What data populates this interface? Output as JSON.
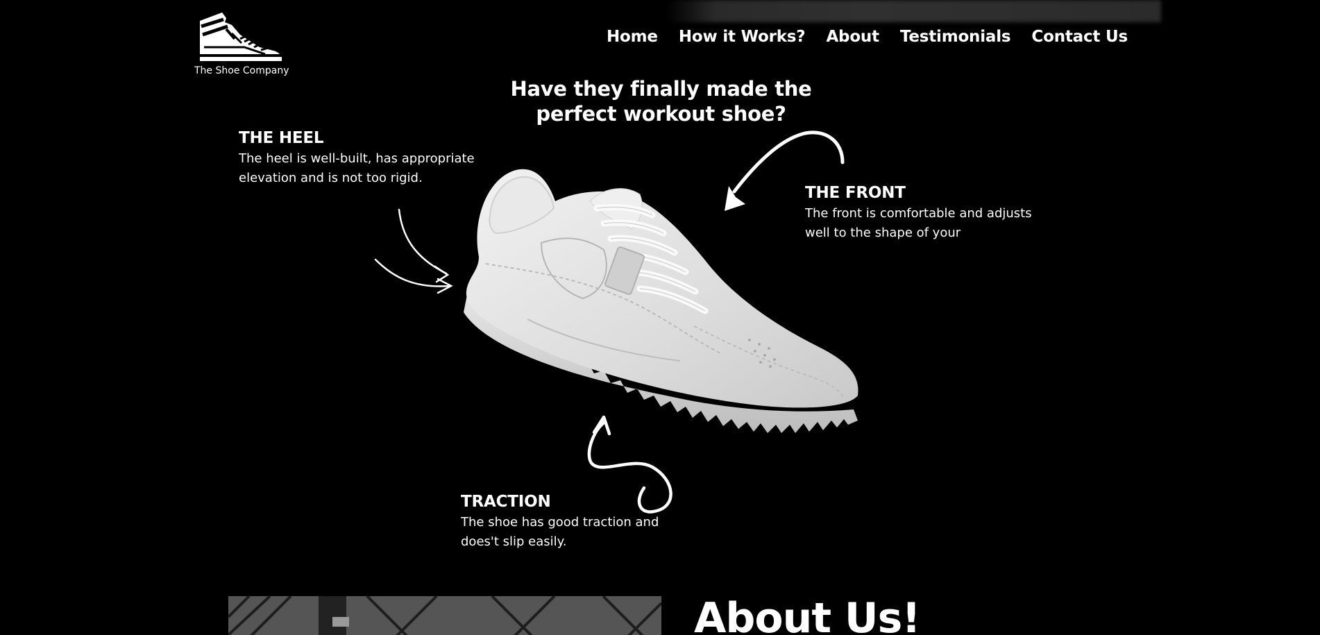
{
  "brand": {
    "name": "The Shoe Company",
    "logo_icon": "sneaker-logo-icon"
  },
  "nav": {
    "items": [
      {
        "label": "Home"
      },
      {
        "label": "How it Works?"
      },
      {
        "label": "About"
      },
      {
        "label": "Testimonials"
      },
      {
        "label": "Contact Us"
      }
    ]
  },
  "hero": {
    "title_line1": "Have they finally made the",
    "title_line2": "perfect workout shoe?",
    "shoe_image": "white-sneaker-image"
  },
  "features": {
    "heel": {
      "title": "THE HEEL",
      "text_line1": "The heel is well-built, has appropriate",
      "text_line2": "elevation and is not too rigid."
    },
    "front": {
      "title": "THE FRONT",
      "text_line1": "The front is comfortable and adjusts",
      "text_line2": "well to the shape of your"
    },
    "traction": {
      "title": "TRACTION",
      "text_line1": "The shoe has good traction and",
      "text_line2": "does't slip easily."
    }
  },
  "about": {
    "title": "About Us!",
    "image": "street-pavement-photo"
  },
  "colors": {
    "background": "#000000",
    "text": "#ffffff"
  }
}
